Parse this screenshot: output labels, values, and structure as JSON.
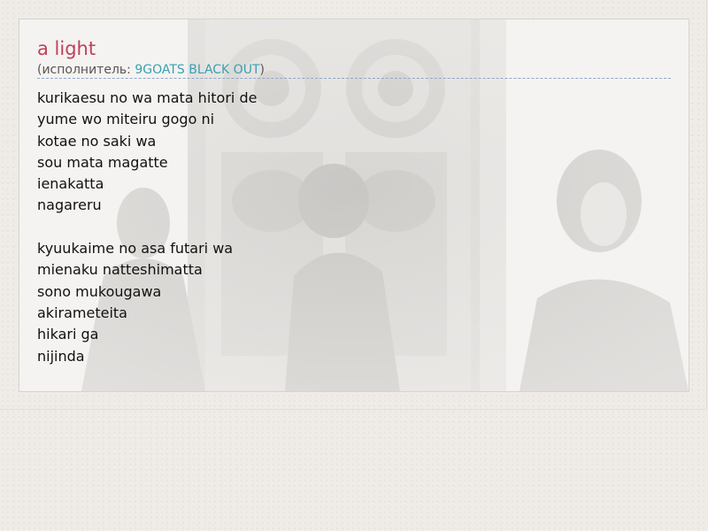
{
  "song": {
    "title": "a light",
    "artist_prefix": "(исполнитель: ",
    "artist_name": "9GOATS BLACK OUT",
    "artist_suffix": ")"
  },
  "lyrics": {
    "stanzas": [
      {
        "lines": [
          "kurikaesu no wa mata hitori de",
          "yume wo miteiru gogo ni",
          "kotae no saki wa",
          "sou mata magatte",
          "ienakatta",
          "nagareru"
        ]
      },
      {
        "lines": [
          "kyuukaime no asa futari wa",
          "mienaku natteshimatta",
          "sono mukougawa",
          "akirameteita",
          "hikari ga",
          "nijinda"
        ]
      }
    ]
  },
  "colors": {
    "title": "#c0415c",
    "artist_link": "#3aa0b2",
    "divider": "#8fa6c9",
    "page_background": "#efebe7",
    "card_background": "#f4f3f1"
  }
}
